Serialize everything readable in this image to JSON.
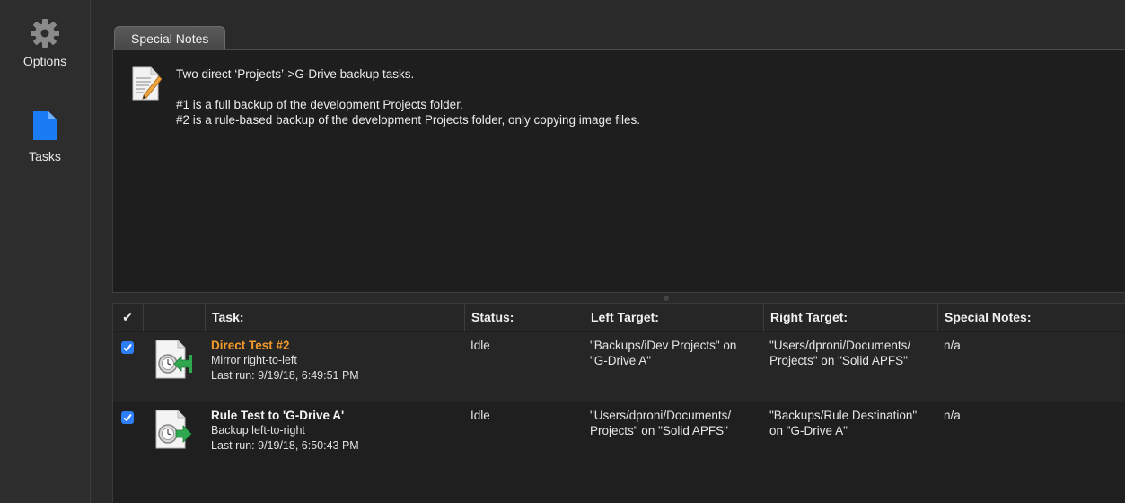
{
  "sidebar": {
    "items": [
      {
        "label": "Options",
        "icon": "gear-icon"
      },
      {
        "label": "Tasks",
        "icon": "document-icon"
      }
    ],
    "accent": "#1a7cf5"
  },
  "notes": {
    "tab_label": "Special Notes",
    "line1": "Two direct ‘Projects’->G-Drive backup tasks.",
    "line2": "#1 is a full backup of the development Projects folder.",
    "line3": "#2 is a rule-based backup of the development Projects folder, only copying image files."
  },
  "table": {
    "headers": {
      "check": "✔",
      "task": "Task:",
      "status": "Status:",
      "left": "Left Target:",
      "right": "Right Target:",
      "notes": "Special Notes:"
    },
    "rows": [
      {
        "checked": true,
        "name": "Direct Test #2",
        "name_color": "#f39a2b",
        "mode": "Mirror right-to-left",
        "last_run": "Last run: 9/19/18, 6:49:51 PM",
        "status": "Idle",
        "left_line1": "\"Backups/iDev Projects\" on",
        "left_line2": "\"G-Drive A\"",
        "right_line1": "\"Users/dproni/Documents/",
        "right_line2": "Projects\" on \"Solid APFS\"",
        "notes": "n/a",
        "icon": "mirror-left-icon"
      },
      {
        "checked": true,
        "name": "Rule Test to 'G-Drive A'",
        "name_color": "#f4f4f4",
        "mode": "Backup left-to-right",
        "last_run": "Last run: 9/19/18, 6:50:43 PM",
        "status": "Idle",
        "left_line1": "\"Users/dproni/Documents/",
        "left_line2": "Projects\" on \"Solid APFS\"",
        "right_line1": "\"Backups/Rule Destination\"",
        "right_line2": "on \"G-Drive A\"",
        "notes": "n/a",
        "icon": "backup-right-icon"
      }
    ]
  }
}
